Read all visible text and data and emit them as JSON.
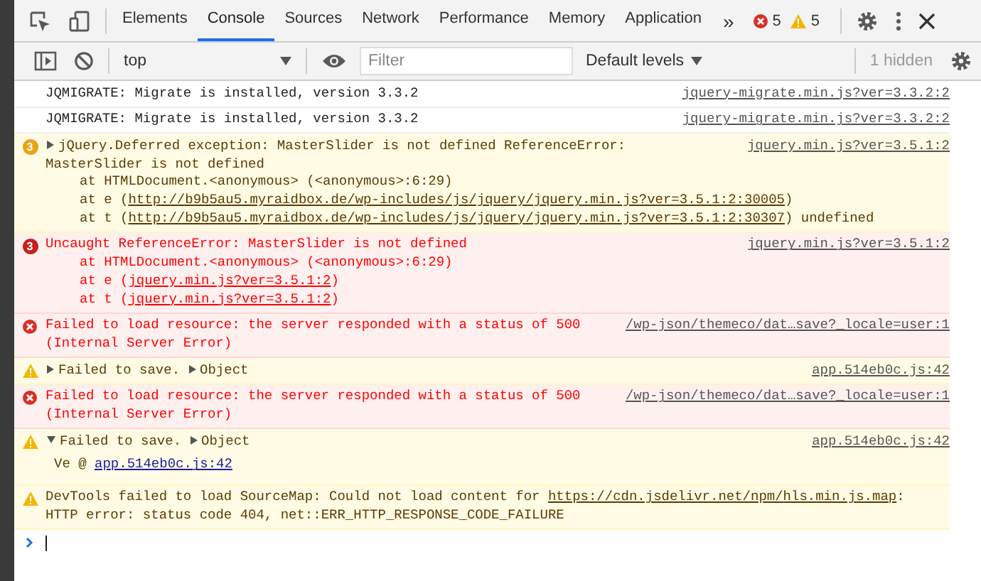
{
  "toolbar": {
    "tabs": [
      {
        "label": "Elements",
        "selected": false
      },
      {
        "label": "Console",
        "selected": true
      },
      {
        "label": "Sources",
        "selected": false
      },
      {
        "label": "Network",
        "selected": false
      },
      {
        "label": "Performance",
        "selected": false
      },
      {
        "label": "Memory",
        "selected": false
      },
      {
        "label": "Application",
        "selected": false
      }
    ],
    "overflow": "»",
    "error_count": "5",
    "warning_count": "5"
  },
  "filter_bar": {
    "context": "top",
    "filter": {
      "placeholder": "Filter"
    },
    "levels": "Default levels",
    "hidden": "1 hidden"
  },
  "messages": [
    {
      "kind": "info",
      "source": "jquery-migrate.min.js?ver=3.3.2:2",
      "lines": [
        {
          "kind": "text",
          "parts": [
            {
              "kind": "text",
              "text": "JQMIGRATE: Migrate is installed, version 3.3.2"
            }
          ]
        }
      ]
    },
    {
      "kind": "info",
      "source": "jquery-migrate.min.js?ver=3.3.2:2",
      "lines": [
        {
          "kind": "text",
          "parts": [
            {
              "kind": "text",
              "text": "JQMIGRATE: Migrate is installed, version 3.3.2"
            }
          ]
        }
      ]
    },
    {
      "kind": "warning",
      "count": "3",
      "expanded": false,
      "source": "jquery.min.js?ver=3.5.1:2",
      "lines": [
        {
          "kind": "text",
          "parts": [
            {
              "kind": "text",
              "text": "jQuery.Deferred exception: MasterSlider is not defined ReferenceError:"
            }
          ]
        },
        {
          "kind": "wrap",
          "parts": [
            {
              "kind": "text",
              "text": "MasterSlider is not defined"
            }
          ]
        },
        {
          "kind": "frame",
          "parts": [
            {
              "kind": "text",
              "text": "at HTMLDocument.<anonymous> (<anonymous>:6:29)"
            }
          ]
        },
        {
          "kind": "frame",
          "parts": [
            {
              "kind": "text",
              "text": "at e ("
            },
            {
              "kind": "link",
              "text": "http://b9b5au5.myraidbox.de/wp-includes/js/jquery/jquery.min.js?ver=3.5.1:2:30005"
            },
            {
              "kind": "text",
              "text": ")"
            }
          ]
        },
        {
          "kind": "frame",
          "parts": [
            {
              "kind": "text",
              "text": "at t ("
            },
            {
              "kind": "link",
              "text": "http://b9b5au5.myraidbox.de/wp-includes/js/jquery/jquery.min.js?ver=3.5.1:2:30307"
            },
            {
              "kind": "text",
              "text": ") undefined"
            }
          ]
        }
      ]
    },
    {
      "kind": "error",
      "count": "3",
      "source": "jquery.min.js?ver=3.5.1:2",
      "lines": [
        {
          "kind": "text",
          "parts": [
            {
              "kind": "text",
              "text": "Uncaught ReferenceError: MasterSlider is not defined"
            }
          ]
        },
        {
          "kind": "frame",
          "parts": [
            {
              "kind": "text",
              "text": "at HTMLDocument.<anonymous> (<anonymous>:6:29)"
            }
          ]
        },
        {
          "kind": "frame",
          "parts": [
            {
              "kind": "text",
              "text": "at e ("
            },
            {
              "kind": "link",
              "text": "jquery.min.js?ver=3.5.1:2"
            },
            {
              "kind": "text",
              "text": ")"
            }
          ]
        },
        {
          "kind": "frame",
          "parts": [
            {
              "kind": "text",
              "text": "at t ("
            },
            {
              "kind": "link",
              "text": "jquery.min.js?ver=3.5.1:2"
            },
            {
              "kind": "text",
              "text": ")"
            }
          ]
        }
      ]
    },
    {
      "kind": "error",
      "source": "/wp-json/themeco/dat…save?_locale=user:1",
      "lines": [
        {
          "kind": "text",
          "parts": [
            {
              "kind": "text",
              "text": "Failed to load resource: the server responded with a status of 500"
            }
          ]
        },
        {
          "kind": "text",
          "parts": [
            {
              "kind": "text",
              "text": "(Internal Server Error)"
            }
          ]
        }
      ]
    },
    {
      "kind": "warning",
      "expanded": false,
      "source": "app.514eb0c.js:42",
      "lines": [
        {
          "kind": "text",
          "parts": [
            {
              "kind": "text",
              "text": "Failed to save."
            },
            {
              "kind": "object",
              "text": "Object"
            }
          ]
        }
      ]
    },
    {
      "kind": "error",
      "source": "/wp-json/themeco/dat…save?_locale=user:1",
      "lines": [
        {
          "kind": "text",
          "parts": [
            {
              "kind": "text",
              "text": "Failed to load resource: the server responded with a status of 500"
            }
          ]
        },
        {
          "kind": "text",
          "parts": [
            {
              "kind": "text",
              "text": "(Internal Server Error)"
            }
          ]
        }
      ]
    },
    {
      "kind": "warning",
      "expanded": true,
      "source": "app.514eb0c.js:42",
      "lines": [
        {
          "kind": "text",
          "parts": [
            {
              "kind": "text",
              "text": "Failed to save."
            },
            {
              "kind": "object",
              "text": "Object"
            }
          ]
        },
        {
          "kind": "trace",
          "parts": [
            {
              "kind": "text",
              "text": "Ve @ "
            },
            {
              "kind": "code-link",
              "text": "app.514eb0c.js:42"
            }
          ]
        }
      ]
    },
    {
      "kind": "warning",
      "lines": [
        {
          "kind": "text",
          "parts": [
            {
              "kind": "text",
              "text": "DevTools failed to load SourceMap: Could not load content for "
            },
            {
              "kind": "link",
              "text": "https://cdn.jsdelivr.net/npm/hls.min.js.map"
            },
            {
              "kind": "text",
              "text": ":"
            }
          ]
        },
        {
          "kind": "text",
          "parts": [
            {
              "kind": "text",
              "text": "HTTP error: status code 404, net::ERR_HTTP_RESPONSE_CODE_FAILURE"
            }
          ]
        }
      ]
    }
  ]
}
